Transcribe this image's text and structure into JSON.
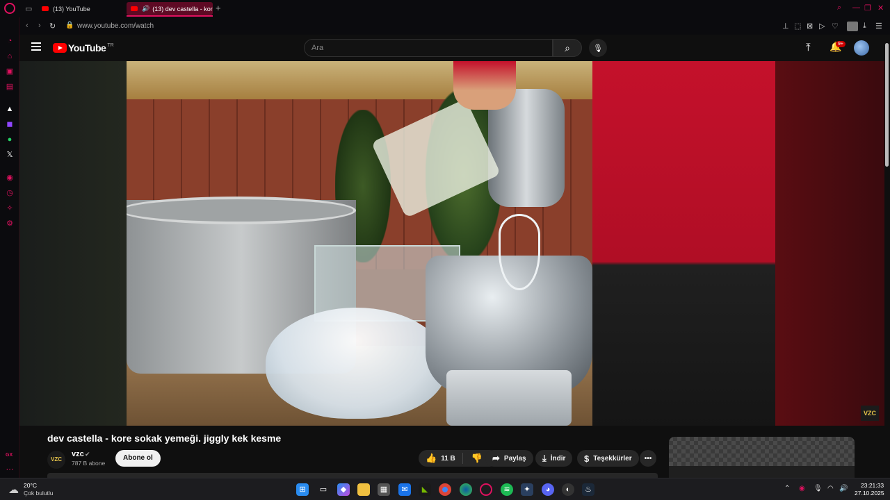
{
  "browser": {
    "tabs": [
      {
        "title": "(13) YouTube",
        "active": false
      },
      {
        "title": "(13) dev castella - kore",
        "active": true
      }
    ],
    "new_tab": "+",
    "url": "www.youtube.com/watch",
    "accent": "#e0115f"
  },
  "youtube": {
    "logo": "YouTube",
    "region": "TR",
    "search_placeholder": "Ara",
    "notif_badge": "9+",
    "video": {
      "title": "dev castella - kore sokak yemeği. jiggly kek kesme",
      "watermark": "VZC"
    },
    "channel": {
      "avatar_text": "VZC",
      "name": "vzc",
      "subscribers": "787 B abone",
      "subscribe": "Abone ol"
    },
    "actions": {
      "likes": "11 B",
      "share": "Paylaş",
      "download": "İndir",
      "thanks": "Teşekkürler"
    }
  },
  "taskbar": {
    "weather_temp": "20°C",
    "weather_desc": "Çok bulutlu",
    "time": "23:21:33",
    "date": "27.10.2025"
  }
}
